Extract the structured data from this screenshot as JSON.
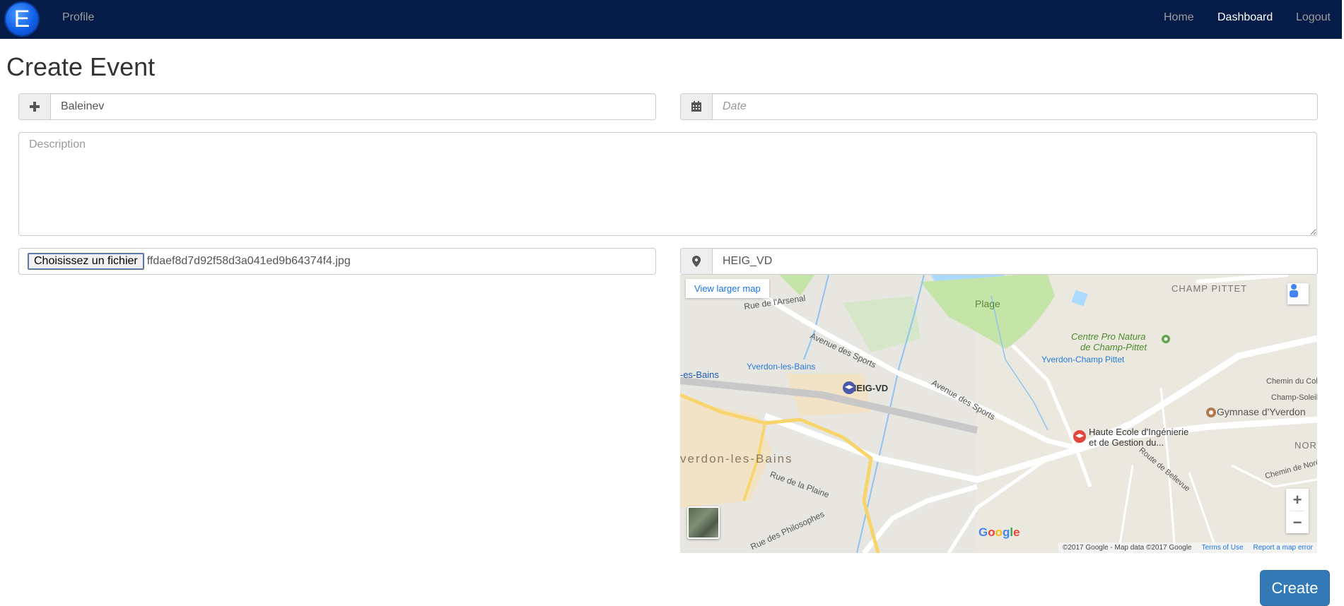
{
  "navbar": {
    "logo_letter": "E",
    "profile_link": "Profile",
    "home_link": "Home",
    "dashboard_link": "Dashboard",
    "logout_link": "Logout",
    "bg_color": "#041c47"
  },
  "page": {
    "title": "Create Event"
  },
  "form": {
    "name_value": "Baleinev",
    "name_icon": "plus-icon",
    "date_placeholder": "Date",
    "date_icon": "calendar-icon",
    "description_placeholder": "Description",
    "file_button_label": "Choisissez un fichier",
    "file_name": "ffdaef8d7d92f58d3a041ed9b64374f4.jpg",
    "location_value": "HEIG_VD",
    "location_icon": "map-marker-icon",
    "create_button_label": "Create",
    "create_button_color": "#337ab7"
  },
  "map": {
    "view_larger_link": "View larger map",
    "labels": {
      "champ_pittet": "CHAMP PITTET",
      "plage": "Plage",
      "centre_pro_natura": "Centre Pro Natura",
      "de_champ_pittet": "de Champ-Pittet",
      "yverdon_champ_pittet": "Yverdon-Champ Pittet",
      "avenue_des_sports": "Avenue des Sports",
      "avenue_des_sports_2": "Avenue des Sports",
      "heig_vd": "HEIG-VD",
      "yverdon_station": "Yverdon-les-Bains",
      "les_bains": "-es-Bains",
      "yverdon_les_bains": "verdon-les-Bains",
      "haute_ecole_1": "Haute Ecole d'Ingénierie",
      "haute_ecole_2": "et de Gestion du...",
      "gymnase": "Gymnase d'Yverdon",
      "rue_de_la_plaine": "Rue de la Plaine",
      "rue_des_philosophes": "Rue des Philosophes",
      "route_de_belleuve": "Route de Bellevue",
      "chemin_du_college": "Chemin du College",
      "champ_soleil": "Champ-Soleil",
      "chemin_de_noreaz": "Chemin de Noréaz",
      "nor": "NOR",
      "rue_de_l_arsenal": "Rue de l'Arsenal"
    },
    "google_logo": "Google",
    "copyright": "©2017 Google - Map data ©2017 Google",
    "terms": "Terms of Use",
    "report": "Report a map error"
  }
}
